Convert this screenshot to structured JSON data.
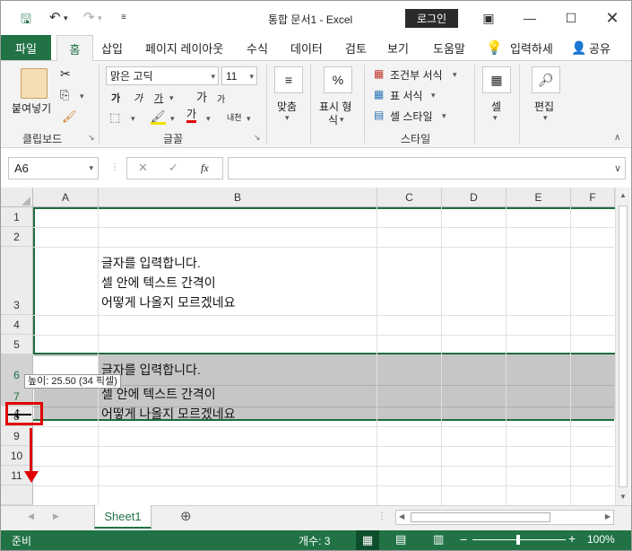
{
  "title_bar": {
    "doc_title": "통합 문서1  -  Excel",
    "login": "로그인"
  },
  "tabs": [
    "파일",
    "홈",
    "삽입",
    "페이지 레이아웃",
    "수식",
    "데이터",
    "검토",
    "보기",
    "도움말",
    "입력하세",
    "공유"
  ],
  "ribbon": {
    "clipboard": {
      "paste": "붙여넣기",
      "label": "클립보드"
    },
    "font": {
      "name": "맑은 고딕",
      "size": "11",
      "bold": "가",
      "italic": "가",
      "underline": "가",
      "grow": "가",
      "shrink": "가",
      "color_char": "가",
      "phonetic": "내천",
      "label": "글꼴"
    },
    "alignment": {
      "label": "맞춤"
    },
    "number": {
      "symbol": "%",
      "label1": "표시 형",
      "label2": "식"
    },
    "styles": {
      "conditional": "조건부 서식",
      "table": "표 서식",
      "cell_style": "셀 스타일",
      "label": "스타일"
    },
    "cells": {
      "label": "셀"
    },
    "editing": {
      "label": "편집"
    }
  },
  "formula_bar": {
    "name_box": "A6",
    "fx": "fx"
  },
  "columns": [
    "A",
    "B",
    "C",
    "D",
    "E",
    "F"
  ],
  "rows": [
    "1",
    "2",
    "3",
    "4",
    "5",
    "6",
    "7",
    "8",
    "9",
    "10",
    "11"
  ],
  "cells": {
    "b3_line1": "글자를 입력합니다.",
    "b3_line2": "셀 안에 텍스트 간격이",
    "b3_line3": "어떻게 나올지 모르겠네요",
    "b6_line1": "글자를 입력합니다.",
    "b6_line2": "셀 안에 텍스트 간격이",
    "b6_line3": "어떻게 나올지 모르겠네요"
  },
  "tooltip": "높이: 25.50 (34 픽셀)",
  "sheet_tab": "Sheet1",
  "status": {
    "ready": "준비",
    "count": "개수: 3",
    "zoom": "100%"
  },
  "colors": {
    "excel_green": "#217346",
    "highlight_red": "#e00000",
    "selection_gray": "#c6c6c6"
  }
}
